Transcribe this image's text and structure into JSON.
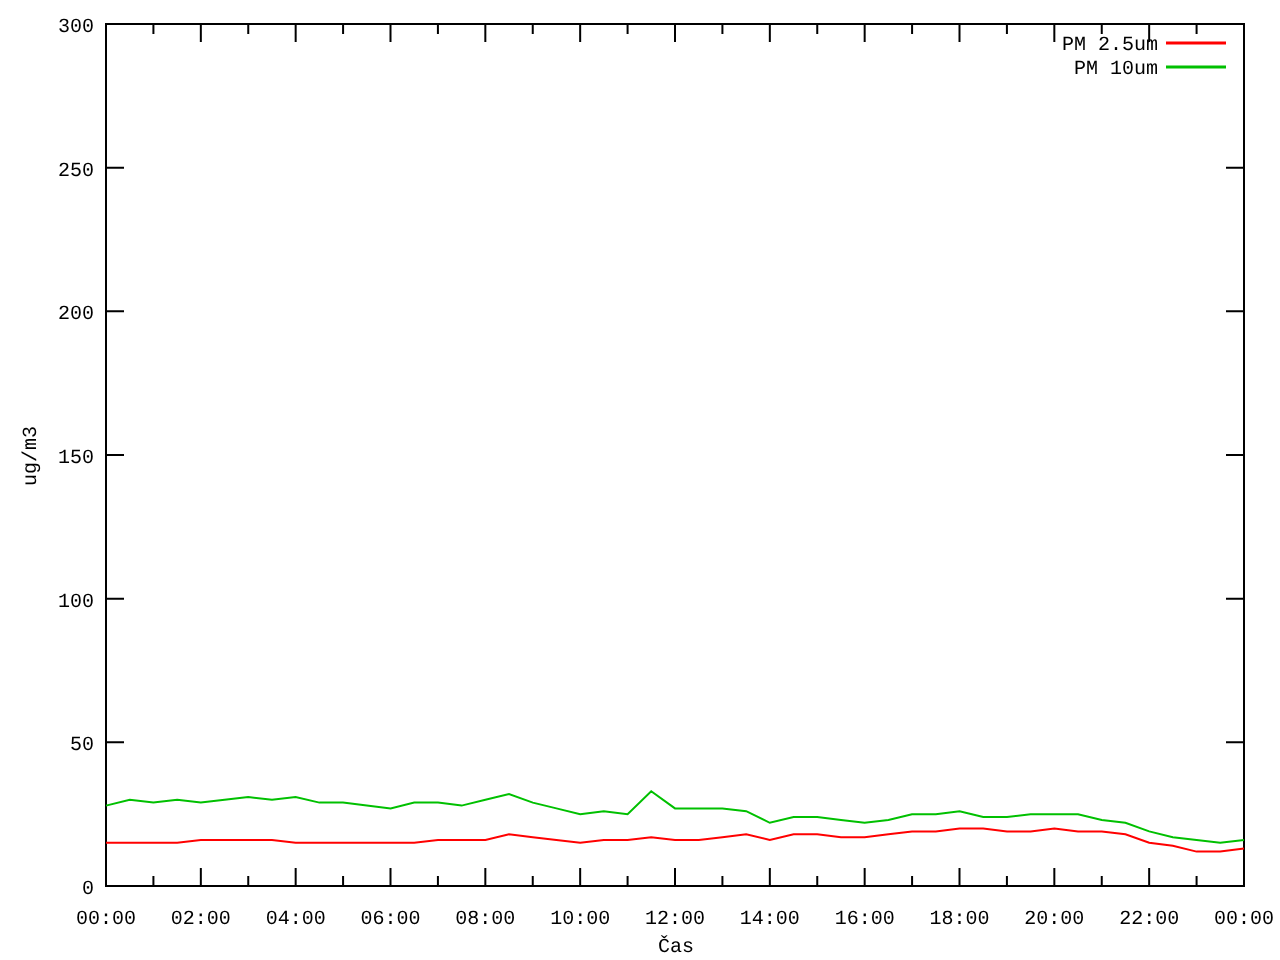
{
  "chart_data": {
    "type": "line",
    "xlabel": "Čas",
    "ylabel": "ug/m3",
    "xlim": [
      0,
      24
    ],
    "legend": "top right",
    "ylim": [
      0,
      300
    ],
    "x": [
      0,
      0.5,
      1,
      1.5,
      2,
      2.5,
      3,
      3.5,
      4,
      4.5,
      5,
      5.5,
      6,
      6.5,
      7,
      7.5,
      8,
      8.5,
      9,
      9.5,
      10,
      10.5,
      11,
      11.5,
      12,
      12.5,
      13,
      13.5,
      14,
      14.5,
      15,
      15.5,
      16,
      16.5,
      17,
      17.5,
      18,
      18.5,
      19,
      19.5,
      20,
      20.5,
      21,
      21.5,
      22,
      22.5,
      23,
      23.5,
      24
    ],
    "xticks": [
      {
        "value": 0,
        "label": "00:00"
      },
      {
        "value": 2,
        "label": "02:00"
      },
      {
        "value": 4,
        "label": "04:00"
      },
      {
        "value": 6,
        "label": "06:00"
      },
      {
        "value": 8,
        "label": "08:00"
      },
      {
        "value": 10,
        "label": "10:00"
      },
      {
        "value": 12,
        "label": "12:00"
      },
      {
        "value": 14,
        "label": "14:00"
      },
      {
        "value": 16,
        "label": "16:00"
      },
      {
        "value": 18,
        "label": "18:00"
      },
      {
        "value": 20,
        "label": "20:00"
      },
      {
        "value": 22,
        "label": "22:00"
      },
      {
        "value": 24,
        "label": "00:00"
      }
    ],
    "yticks": [
      0,
      50,
      100,
      150,
      200,
      250,
      300
    ],
    "series": [
      {
        "name": "PM 2.5um",
        "color": "#ff0000",
        "values": [
          15,
          15,
          15,
          15,
          16,
          16,
          16,
          16,
          15,
          15,
          15,
          15,
          15,
          15,
          16,
          16,
          16,
          18,
          17,
          16,
          15,
          16,
          16,
          17,
          16,
          16,
          17,
          18,
          16,
          18,
          18,
          17,
          17,
          18,
          19,
          19,
          20,
          20,
          19,
          19,
          20,
          19,
          19,
          18,
          15,
          14,
          12,
          12,
          13
        ]
      },
      {
        "name": "PM 10um",
        "color": "#00c000",
        "values": [
          28,
          30,
          29,
          30,
          29,
          30,
          31,
          30,
          31,
          29,
          29,
          28,
          27,
          29,
          29,
          28,
          30,
          32,
          29,
          27,
          25,
          26,
          25,
          33,
          27,
          27,
          27,
          26,
          22,
          24,
          24,
          23,
          22,
          23,
          25,
          25,
          26,
          24,
          24,
          25,
          25,
          25,
          23,
          22,
          19,
          17,
          16,
          15,
          16
        ]
      }
    ]
  }
}
